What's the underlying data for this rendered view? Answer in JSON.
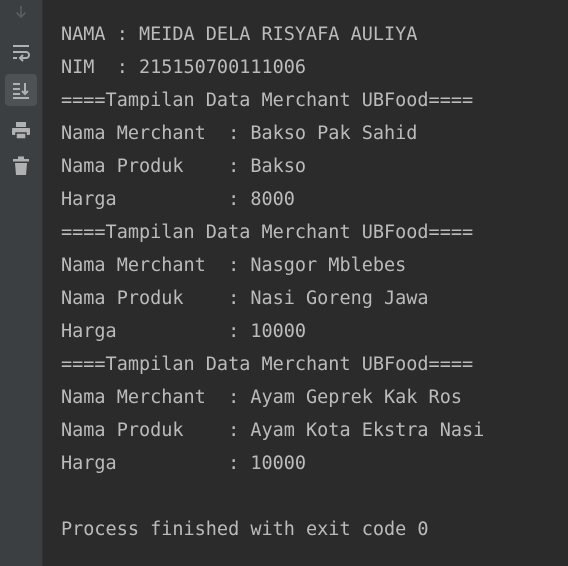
{
  "console": {
    "lines": [
      "NAMA : MEIDA DELA RISYAFA AULIYA",
      "NIM  : 215150700111006",
      "====Tampilan Data Merchant UBFood====",
      "Nama Merchant  : Bakso Pak Sahid",
      "Nama Produk    : Bakso",
      "Harga          : 8000",
      "====Tampilan Data Merchant UBFood====",
      "Nama Merchant  : Nasgor Mblebes",
      "Nama Produk    : Nasi Goreng Jawa",
      "Harga          : 10000",
      "====Tampilan Data Merchant UBFood====",
      "Nama Merchant  : Ayam Geprek Kak Ros",
      "Nama Produk    : Ayam Kota Ekstra Nasi",
      "Harga          : 10000",
      "",
      "Process finished with exit code 0"
    ]
  },
  "toolbar": {
    "buttons": [
      {
        "icon": "arrow-down-icon",
        "active": false
      },
      {
        "icon": "soft-wrap-icon",
        "active": false
      },
      {
        "icon": "scroll-to-end-icon",
        "active": true
      },
      {
        "icon": "print-icon",
        "active": false
      },
      {
        "icon": "trash-icon",
        "active": false
      }
    ]
  },
  "colors": {
    "background": "#2b2b2b",
    "gutter": "#3c3f41",
    "text": "#bbbbbb",
    "icon": "#afb1b3"
  }
}
